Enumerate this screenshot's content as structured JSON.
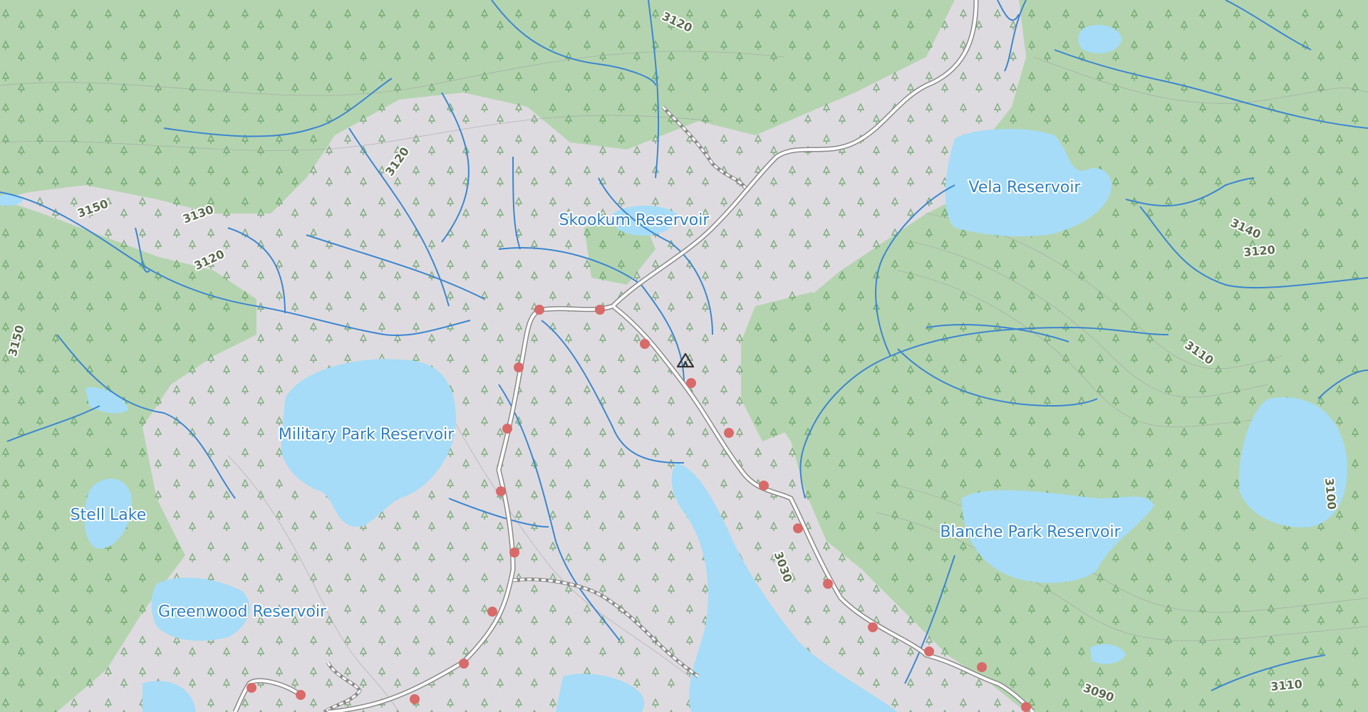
{
  "map": {
    "colors": {
      "land": "#dedbe0",
      "forest": "#b4d4b0",
      "water": "#a6dcf7",
      "stream": "#3c86cf",
      "road": "#ffffff",
      "road_casing": "#8a8a8a",
      "trail_marker": "#d86a6a"
    },
    "lakes": [
      {
        "name": "Skookum Reservoir"
      },
      {
        "name": "Vela Reservoir"
      },
      {
        "name": "Military Park Reservoir"
      },
      {
        "name": "Stell Lake"
      },
      {
        "name": "Greenwood Reservoir"
      },
      {
        "name": "Blanche Park Reservoir"
      }
    ],
    "contour_labels": [
      "3120",
      "3150",
      "3130",
      "3120",
      "3120",
      "3150",
      "3140",
      "3120",
      "3110",
      "3100",
      "3030",
      "3090",
      "3110"
    ],
    "icons": [
      "campsite-icon"
    ]
  }
}
